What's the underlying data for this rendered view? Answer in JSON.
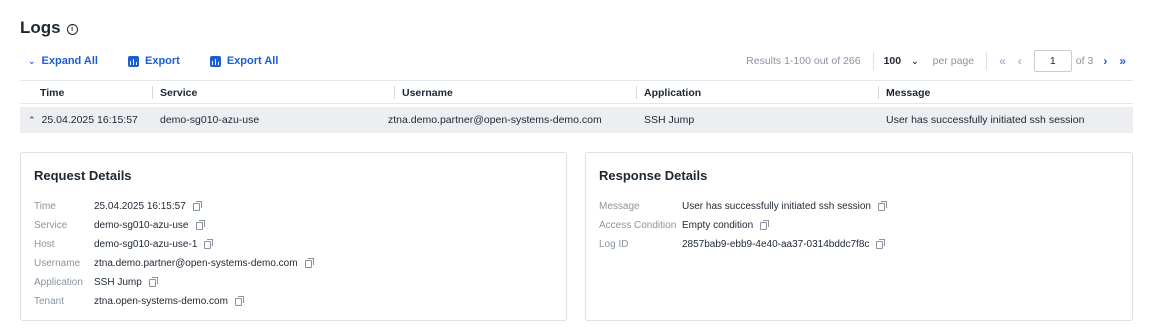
{
  "page": {
    "title": "Logs",
    "info_icon": "info-circle-icon"
  },
  "toolbar": {
    "expand_all": "Expand All",
    "export": "Export",
    "export_all": "Export All"
  },
  "pagination": {
    "results": "Results 1-100 out of 266",
    "per_page_value": "100",
    "per_page_label": "per page",
    "current_page": "1",
    "of_pages": "of 3"
  },
  "table": {
    "columns": [
      "Time",
      "Service",
      "Username",
      "Application",
      "Message"
    ],
    "rows": [
      {
        "time": "25.04.2025 16:15:57",
        "service": "demo-sg010-azu-use",
        "username": "ztna.demo.partner@open-systems-demo.com",
        "application": "SSH Jump",
        "message": "User has successfully initiated ssh session"
      }
    ]
  },
  "request_details": {
    "title": "Request Details",
    "fields": [
      {
        "label": "Time",
        "value": "25.04.2025 16:15:57"
      },
      {
        "label": "Service",
        "value": "demo-sg010-azu-use"
      },
      {
        "label": "Host",
        "value": "demo-sg010-azu-use-1"
      },
      {
        "label": "Username",
        "value": "ztna.demo.partner@open-systems-demo.com"
      },
      {
        "label": "Application",
        "value": "SSH Jump"
      },
      {
        "label": "Tenant",
        "value": "ztna.open-systems-demo.com"
      }
    ]
  },
  "response_details": {
    "title": "Response Details",
    "fields": [
      {
        "label": "Message",
        "value": "User has successfully initiated ssh session"
      },
      {
        "label": "Access Condition",
        "value": "Empty condition"
      },
      {
        "label": "Log ID",
        "value": "2857bab9-ebb9-4e40-aa37-0314bddc7f8c"
      }
    ]
  },
  "colors": {
    "accent": "#1a5fd6",
    "row_highlight": "#eceef1",
    "muted": "#8a94a0"
  }
}
